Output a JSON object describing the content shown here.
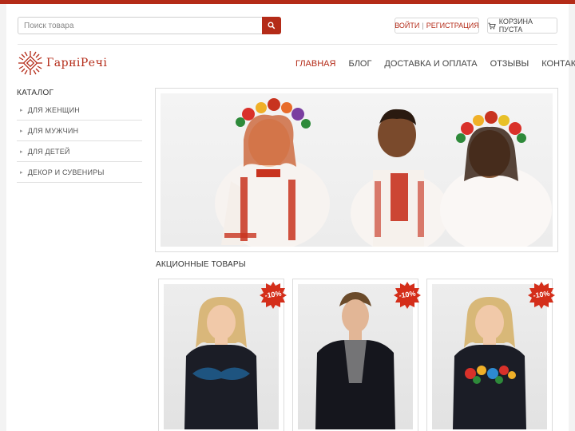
{
  "header": {
    "search": {
      "placeholder": "Поиск товара",
      "value": "",
      "button_icon": "search-icon"
    },
    "auth": {
      "login": "ВОЙТИ",
      "separator": "|",
      "register": "РЕГИСТРАЦИЯ"
    },
    "cart": {
      "icon": "cart-icon",
      "label": "КОРЗИНА ПУСТА"
    }
  },
  "logo": {
    "text": "ГарніРечі",
    "icon": "sun-ornament-icon"
  },
  "nav": {
    "items": [
      {
        "label": "ГЛАВНАЯ",
        "active": true
      },
      {
        "label": "БЛОГ",
        "active": false
      },
      {
        "label": "ДОСТАВКА И ОПЛАТА",
        "active": false
      },
      {
        "label": "ОТЗЫВЫ",
        "active": false
      },
      {
        "label": "КОНТАКТЫ",
        "active": false
      }
    ]
  },
  "catalog": {
    "title": "КАТАЛОГ",
    "items": [
      {
        "label": "ДЛЯ ЖЕНЩИН"
      },
      {
        "label": "ДЛЯ МУЖЧИН"
      },
      {
        "label": "ДЛЯ ДЕТЕЙ"
      },
      {
        "label": "ДЕКОР И СУВЕНИРЫ"
      }
    ]
  },
  "promo": {
    "title": "АКЦИОННЫЕ ТОВАРЫ",
    "products": [
      {
        "badge": "-10%"
      },
      {
        "badge": "-10%"
      },
      {
        "badge": "-10%"
      }
    ]
  },
  "colors": {
    "accent": "#b42b18",
    "background": "#f3f3f3",
    "text": "#333333"
  }
}
